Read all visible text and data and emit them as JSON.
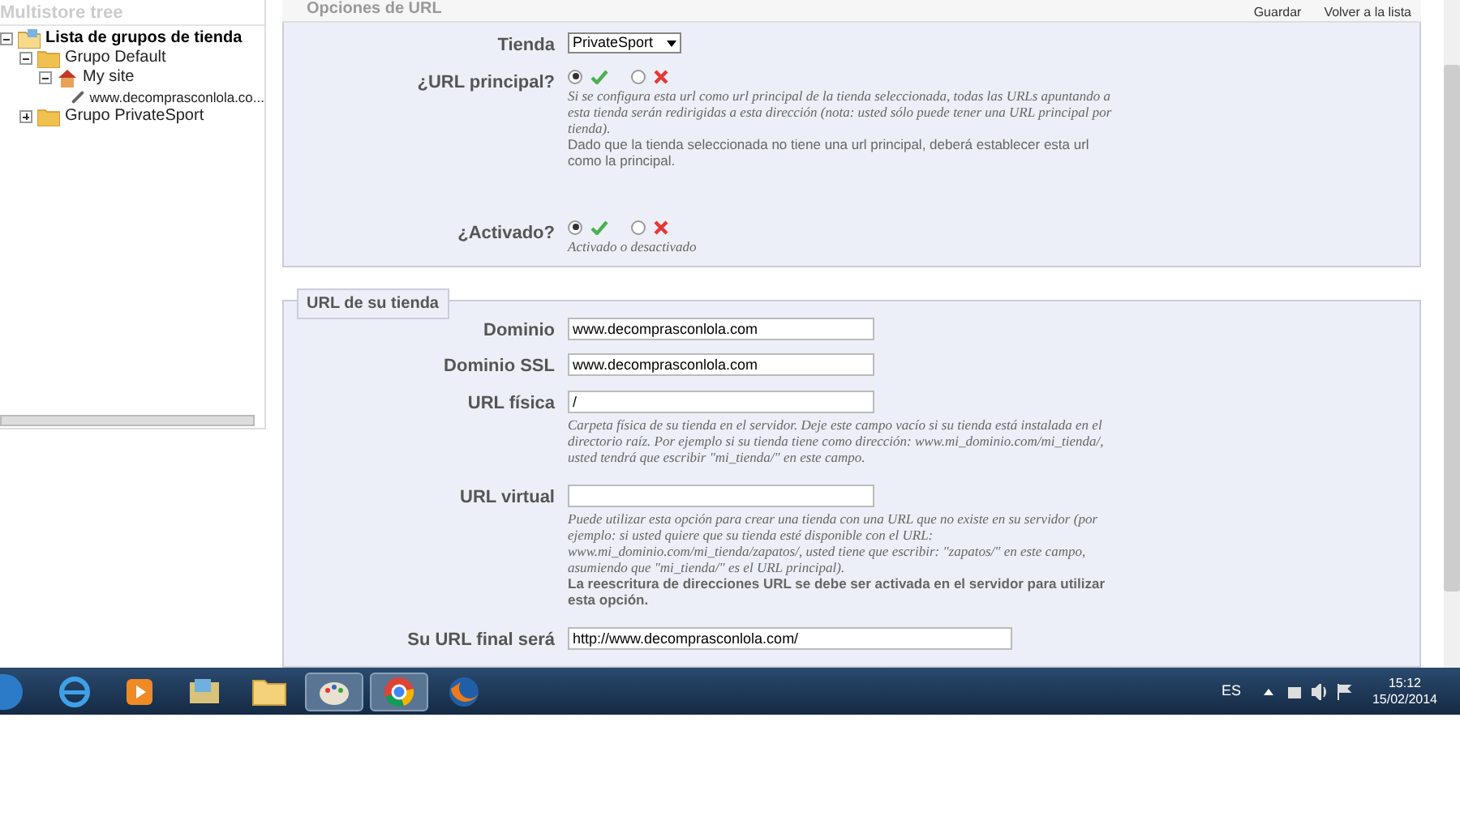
{
  "sidebar": {
    "title": "Multistore tree",
    "tree": [
      {
        "label": "Lista de grupos de tienda",
        "kind": "root",
        "expanded": true,
        "children": [
          {
            "label": "Grupo Default",
            "kind": "group",
            "expanded": true,
            "children": [
              {
                "label": "My site",
                "kind": "shop",
                "expanded": true,
                "children": [
                  {
                    "label": "www.decomprasconlola.co...",
                    "kind": "url"
                  }
                ]
              }
            ]
          },
          {
            "label": "Grupo PrivateSport",
            "kind": "group",
            "expanded": false
          }
        ]
      }
    ]
  },
  "toolbar": [
    "Guardar",
    "Volver a la lista"
  ],
  "options_section": {
    "legend": "Opciones de URL",
    "fields": [
      {
        "kind": "select",
        "label": "Tienda",
        "value": "PrivateSport"
      },
      {
        "kind": "radio",
        "label": "¿URL principal?",
        "yes_selected": true,
        "help": "Si se configura esta url como url principal de la tienda seleccionada, todas las URLs apuntando a esta tienda serán redirigidas a esta dirección (nota: usted sólo puede tener una URL principal por tienda).",
        "note": "Dado que la tienda seleccionada no tiene una url principal, deberá establecer esta url como la principal."
      },
      {
        "kind": "radio",
        "label": "¿Activado?",
        "yes_selected": true,
        "help": "Activado o desactivado"
      }
    ]
  },
  "url_section": {
    "legend": "URL de su tienda",
    "fields": [
      {
        "kind": "text",
        "label": "Dominio",
        "value": "www.decomprasconlola.com"
      },
      {
        "kind": "text",
        "label": "Dominio SSL",
        "value": "www.decomprasconlola.com"
      },
      {
        "kind": "text",
        "label": "URL física",
        "value": "/",
        "help": "Carpeta física de su tienda en el servidor. Deje este campo vacío si su tienda está instalada en el directorio raíz. Por ejemplo si su tienda tiene como dirección: www.mi_dominio.com/mi_tienda/, usted tendrá que escribir \"mi_tienda/\" en este campo."
      },
      {
        "kind": "text",
        "label": "URL virtual",
        "help": "Puede utilizar esta opción para crear una tienda con una URL que no existe en su servidor (por ejemplo: si usted quiere que su tienda esté disponible con el URL: www.mi_dominio.com/mi_tienda/zapatos/, usted tiene que escribir: \"zapatos/\" en este campo, asumiendo que \"mi_tienda/\" es el URL principal).",
        "note": "La reescritura de direcciones URL se debe ser activada en el servidor para utilizar esta opción."
      },
      {
        "kind": "wide",
        "label": "Su URL final será",
        "value": "http://www.decomprasconlola.com/"
      }
    ]
  },
  "taskbar": {
    "apps": [
      {
        "kind": "ie",
        "selected": false
      },
      {
        "kind": "media",
        "selected": false
      },
      {
        "kind": "folder2",
        "selected": false
      },
      {
        "kind": "folder",
        "selected": false
      },
      {
        "kind": "paint",
        "selected": true
      },
      {
        "kind": "chrome",
        "selected": true
      },
      {
        "kind": "firefox",
        "selected": false
      }
    ],
    "language": "ES",
    "time": "15:12",
    "date": "15/02/2014"
  }
}
